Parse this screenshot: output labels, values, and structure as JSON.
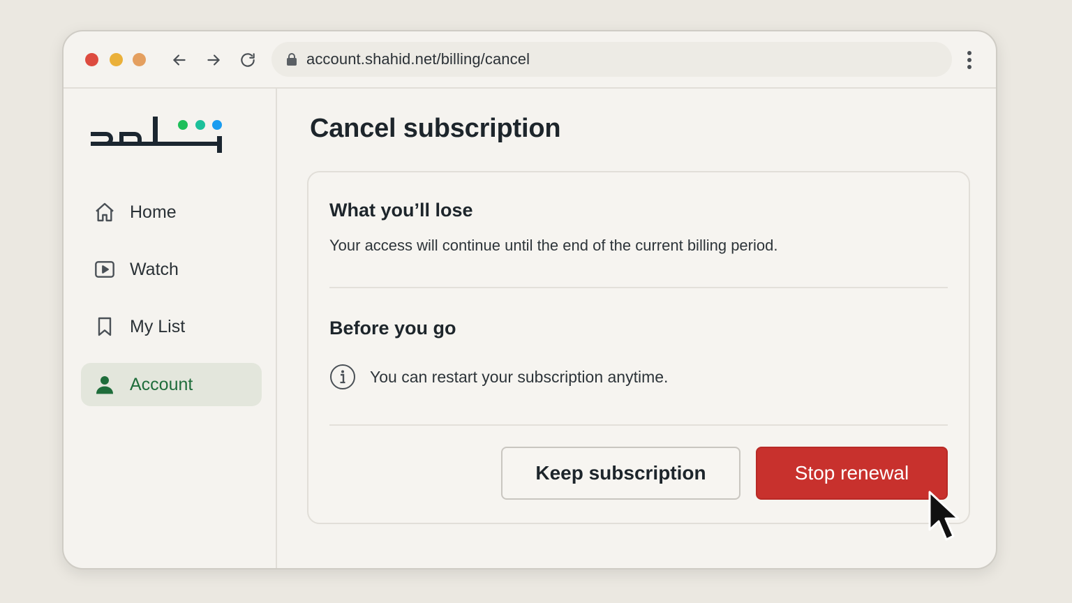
{
  "browser": {
    "url": "account.shahid.net/billing/cancel",
    "traffic_light_colors": [
      "#dd4b3f",
      "#eab039",
      "#e49f5f"
    ]
  },
  "sidebar": {
    "logo_text": "شاهد",
    "logo_dot_colors": [
      "#1fbf5a",
      "#1cc09a",
      "#1a9cf0"
    ],
    "items": [
      {
        "label": "Home",
        "icon": "home-icon"
      },
      {
        "label": "Watch",
        "icon": "play-icon"
      },
      {
        "label": "My List",
        "icon": "bookmark-icon"
      },
      {
        "label": "Account",
        "icon": "user-icon",
        "active": true
      }
    ]
  },
  "main": {
    "title": "Cancel subscription",
    "lose": {
      "heading": "What you’ll lose",
      "text": "Your access will continue until the end of the current billing period."
    },
    "before": {
      "heading": "Before you go",
      "info_text": "You can restart your subscription anytime."
    },
    "buttons": {
      "keep_label": "Keep subscription",
      "stop_label": "Stop renewal"
    }
  },
  "colors": {
    "accent_green": "#1f6d3b",
    "danger_red": "#c8312d"
  }
}
